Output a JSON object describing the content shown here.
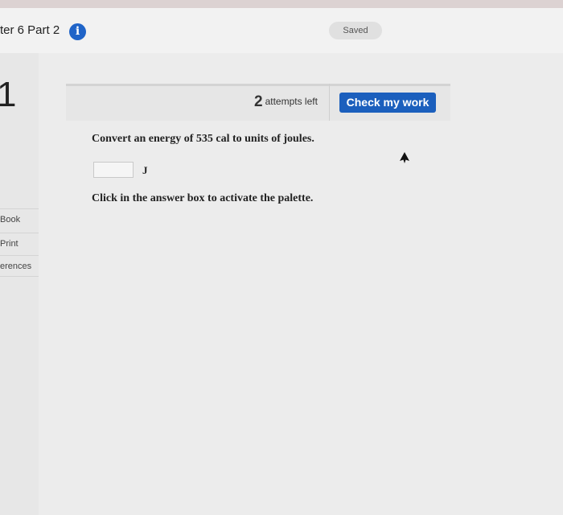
{
  "header": {
    "chapter_title": "ter 6 Part 2",
    "info_icon": "info-icon",
    "saved_label": "Saved"
  },
  "question": {
    "number": "1",
    "attempts_count": "2",
    "attempts_label": "attempts left",
    "check_button_label": "Check my work",
    "prompt": "Convert an energy of 535 cal to units of joules.",
    "answer_value": "",
    "answer_placeholder": "",
    "unit": "J",
    "hint": "Click in the answer box to activate the palette."
  },
  "sidebar": {
    "items": [
      {
        "label": "Book"
      },
      {
        "label": "Print"
      },
      {
        "label": "erences"
      }
    ]
  },
  "colors": {
    "accent": "#1b5fbd",
    "info_icon": "#1f64c8"
  }
}
